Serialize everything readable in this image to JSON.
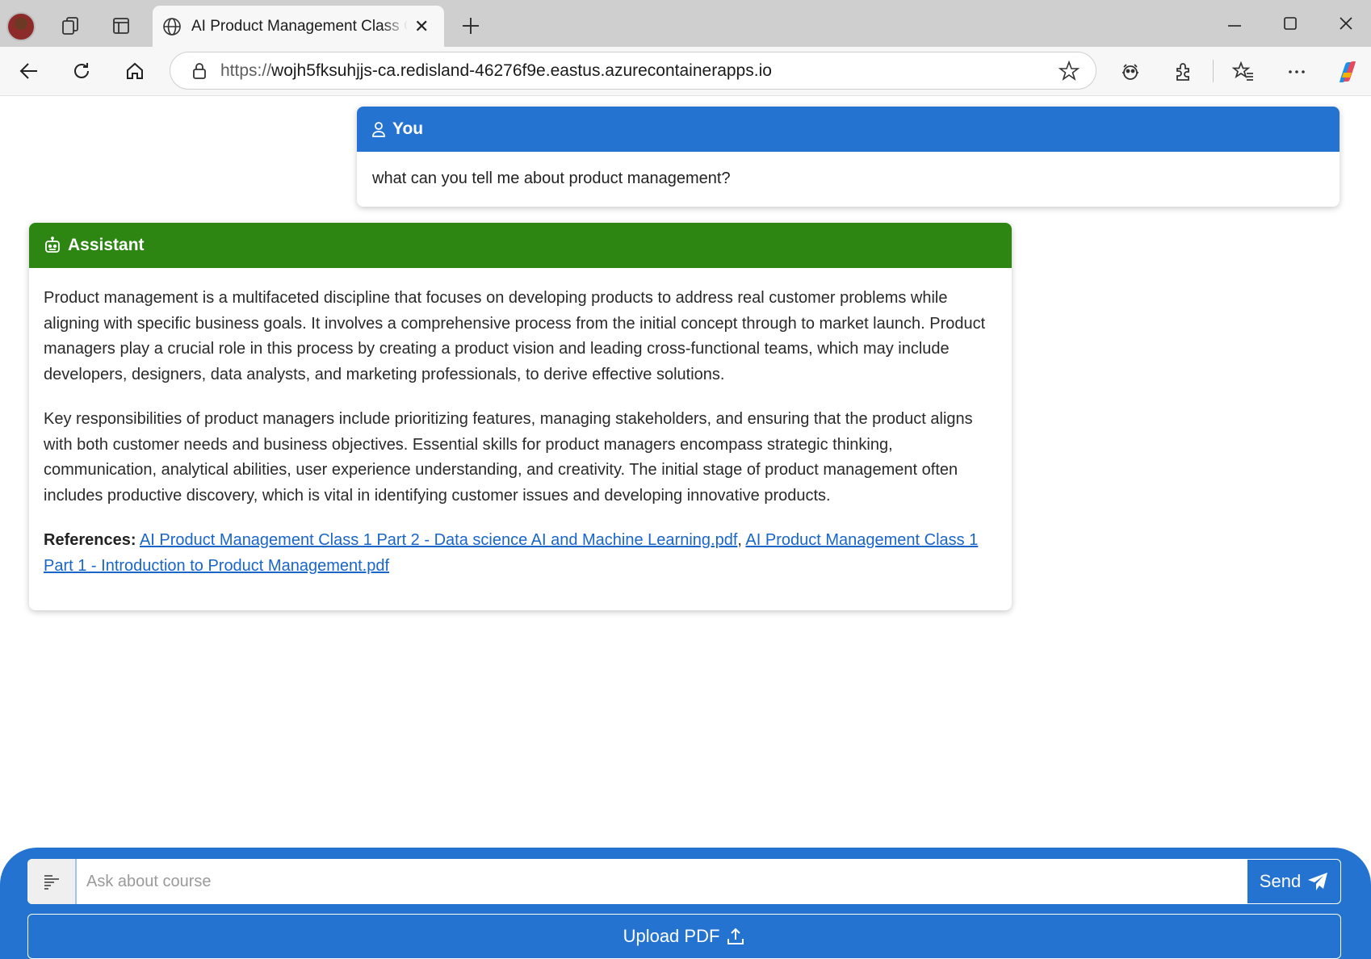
{
  "browser": {
    "tab_title": "AI Product Management Class Co",
    "url_prefix": "https://",
    "url_main": "wojh5fksuhjjs-ca.redisland-46276f9e.eastus.azurecontainerapps.io"
  },
  "user_message": {
    "header": "You",
    "text": "what can you tell me about product management?"
  },
  "assistant_message": {
    "header": "Assistant",
    "paragraph_1": "Product management is a multifaceted discipline that focuses on developing products to address real customer problems while aligning with specific business goals. It involves a comprehensive process from the initial concept through to market launch. Product managers play a crucial role in this process by creating a product vision and leading cross-functional teams, which may include developers, designers, data analysts, and marketing professionals, to derive effective solutions.",
    "paragraph_2": "Key responsibilities of product managers include prioritizing features, managing stakeholders, and ensuring that the product aligns with both customer needs and business objectives. Essential skills for product managers encompass strategic thinking, communication, analytical abilities, user experience understanding, and creativity. The initial stage of product management often includes productive discovery, which is vital in identifying customer issues and developing innovative products.",
    "references_label": "References:",
    "reference_1": "AI Product Management Class 1 Part 2 - Data science AI and Machine Learning.pdf",
    "reference_separator": ", ",
    "reference_2": "AI Product Management Class 1 Part 1 - Introduction to Product Management.pdf"
  },
  "chat_input": {
    "placeholder": "Ask about course",
    "send_label": "Send",
    "upload_label": "Upload PDF"
  },
  "colors": {
    "user_header": "#2473d0",
    "assistant_header": "#2d8512",
    "link": "#1a66c8",
    "bottom_bar": "#2473d0"
  },
  "icons": [
    "profile-avatar",
    "workspaces-icon",
    "tab-actions-icon",
    "globe-icon",
    "close-icon",
    "new-tab-icon",
    "minimize-icon",
    "maximize-icon",
    "window-close-icon",
    "back-icon",
    "refresh-icon",
    "home-icon",
    "lock-icon",
    "favorite-star-icon",
    "extension-puzzle-icon",
    "favorites-icon",
    "more-icon",
    "copilot-icon",
    "user-icon",
    "robot-icon",
    "text-lines-icon",
    "send-icon",
    "upload-icon"
  ]
}
